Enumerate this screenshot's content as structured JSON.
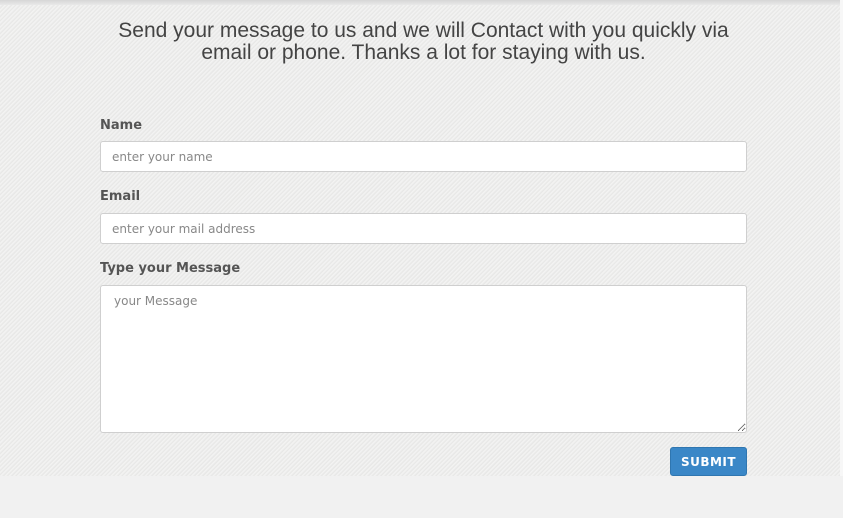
{
  "contact": {
    "intro": "Send your message to us and we will Contact with you quickly via email or phone. Thanks a lot for staying with us.",
    "name_label": "Name",
    "name_placeholder": "enter your name",
    "email_label": "Email",
    "email_placeholder": "enter your mail address",
    "message_label": "Type your Message",
    "message_placeholder": "your Message",
    "submit_label": "SUBMIT",
    "submit_color": "#3a87c7"
  }
}
